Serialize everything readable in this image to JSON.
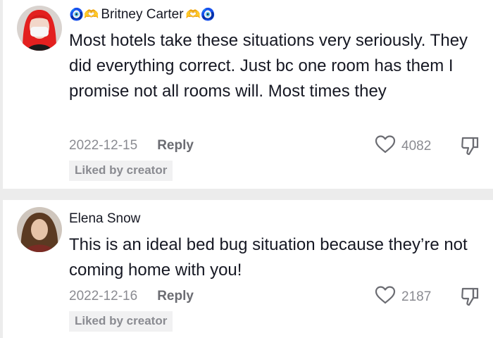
{
  "comments": [
    {
      "username": "Britney Carter",
      "name_prefix_emoji": "🧿🫶",
      "name_suffix_emoji": "🫶🧿",
      "text": "Most hotels take these situations very seriously. They did everything correct. Just bc one room has them I promise not all rooms will. Most times they",
      "date": "2022-12-15",
      "reply_label": "Reply",
      "like_count": "4082",
      "badge": "Liked by creator",
      "icons": {
        "like": "heart-outline-icon",
        "dislike": "thumbs-down-outline-icon"
      }
    },
    {
      "username": "Elena Snow",
      "text": "This is an ideal bed bug situation because they’re not coming home with you!",
      "date": "2022-12-16",
      "reply_label": "Reply",
      "like_count": "2187",
      "badge": "Liked by creator",
      "icons": {
        "like": "heart-outline-icon",
        "dislike": "thumbs-down-outline-icon"
      }
    }
  ],
  "colors": {
    "background": "#ececec",
    "card": "#ffffff",
    "text": "#161823",
    "muted": "#8a8b91"
  }
}
